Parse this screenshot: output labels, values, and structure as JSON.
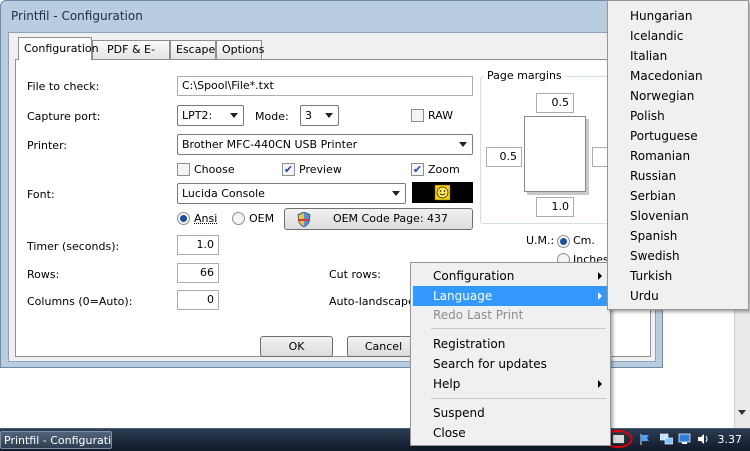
{
  "window": {
    "title": "Printfil - Configuration",
    "tabs": [
      "Configuration",
      "PDF & E-Mail",
      "Escape",
      "Options"
    ]
  },
  "config": {
    "file_to_check_label": "File to check:",
    "file_to_check_value": "C:\\Spool\\File*.txt",
    "capture_port_label": "Capture port:",
    "capture_port_value": "LPT2:",
    "mode_label": "Mode:",
    "mode_value": "3",
    "raw_label": "RAW",
    "printer_label": "Printer:",
    "printer_value": "Brother MFC-440CN USB Printer",
    "choose_label": "Choose",
    "preview_label": "Preview",
    "zoom_label": "Zoom",
    "font_label": "Font:",
    "font_value": "Lucida Console",
    "ansi_label": "Ansi",
    "oem_label": "OEM",
    "oem_code_page_button": "OEM Code Page: 437",
    "timer_label": "Timer (seconds):",
    "timer_value": "1.0",
    "rows_label": "Rows:",
    "rows_value": "66",
    "columns_label": "Columns (0=Auto):",
    "columns_value": "0",
    "cut_rows_label": "Cut rows:",
    "auto_landscape_label": "Auto-landscape a",
    "page_margins_label": "Page margins",
    "margin_top": "0.5",
    "margin_left": "0.5",
    "margin_bottom": "1.0",
    "um_label": "U.M.:",
    "cm_label": "Cm.",
    "inches_label": "Inches",
    "ok_button": "OK",
    "cancel_button": "Cancel"
  },
  "context_menu": {
    "items": [
      {
        "label": "Configuration",
        "submenu": true
      },
      {
        "label": "Language",
        "submenu": true,
        "highlighted": true
      },
      {
        "label": "Redo Last Print",
        "disabled": true
      },
      {
        "label": "Registration"
      },
      {
        "label": "Search for updates"
      },
      {
        "label": "Help",
        "submenu": true
      },
      {
        "label": "Suspend"
      },
      {
        "label": "Close"
      }
    ]
  },
  "language_menu": {
    "items": [
      "Hungarian",
      "Icelandic",
      "Italian",
      "Macedonian",
      "Norwegian",
      "Polish",
      "Portuguese",
      "Romanian",
      "Russian",
      "Serbian",
      "Slovenian",
      "Spanish",
      "Swedish",
      "Turkish",
      "Urdu"
    ]
  },
  "taskbar": {
    "button_label": "Printfil - Configurati...",
    "clock": "3.37"
  },
  "colors": {
    "highlight": "#3399ff",
    "window_frame": "#b8cde0",
    "taskbar": "#1a2638",
    "tray_circle": "#e00000"
  }
}
